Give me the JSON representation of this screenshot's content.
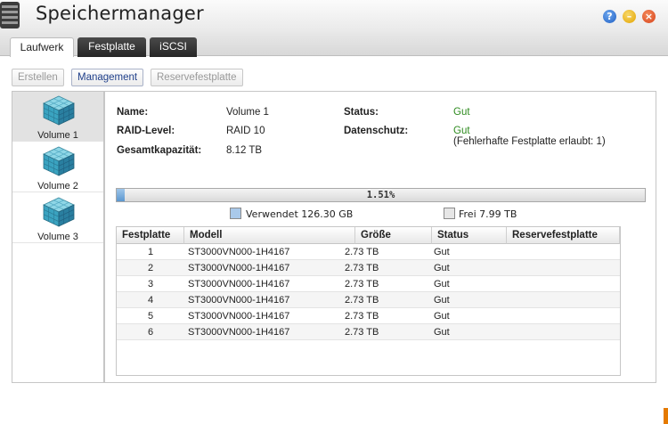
{
  "window": {
    "title": "Speichermanager"
  },
  "tabs": [
    {
      "label": "Laufwerk"
    },
    {
      "label": "Festplatte"
    },
    {
      "label": "iSCSI"
    }
  ],
  "toolbar": {
    "create_label": "Erstellen",
    "management_label": "Management",
    "spare_label": "Reservefestplatte"
  },
  "volumes": [
    {
      "label": "Volume 1"
    },
    {
      "label": "Volume 2"
    },
    {
      "label": "Volume 3"
    }
  ],
  "details": {
    "name_label": "Name:",
    "name_value": "Volume 1",
    "raid_label": "RAID-Level:",
    "raid_value": "RAID 10",
    "capacity_label": "Gesamtkapazität:",
    "capacity_value": "8.12 TB",
    "status_label": "Status:",
    "status_value": "Gut",
    "protection_label": "Datenschutz:",
    "protection_value": "Gut",
    "protection_note": "(Fehlerhafte Festplatte erlaubt: 1)"
  },
  "usage": {
    "percent_text": "1.51%",
    "percent_value": 1.51,
    "used_label": "Verwendet 126.30 GB",
    "free_label": "Frei 7.99 TB"
  },
  "table": {
    "headers": [
      "Festplatte",
      "Modell",
      "Größe",
      "Status",
      "Reservefestplatte"
    ],
    "rows": [
      {
        "disk": "1",
        "model": "ST3000VN000-1H4167",
        "size": "2.73 TB",
        "status": "Gut",
        "spare": ""
      },
      {
        "disk": "2",
        "model": "ST3000VN000-1H4167",
        "size": "2.73 TB",
        "status": "Gut",
        "spare": ""
      },
      {
        "disk": "3",
        "model": "ST3000VN000-1H4167",
        "size": "2.73 TB",
        "status": "Gut",
        "spare": ""
      },
      {
        "disk": "4",
        "model": "ST3000VN000-1H4167",
        "size": "2.73 TB",
        "status": "Gut",
        "spare": ""
      },
      {
        "disk": "5",
        "model": "ST3000VN000-1H4167",
        "size": "2.73 TB",
        "status": "Gut",
        "spare": ""
      },
      {
        "disk": "6",
        "model": "ST3000VN000-1H4167",
        "size": "2.73 TB",
        "status": "Gut",
        "spare": ""
      }
    ]
  },
  "colors": {
    "good": "#2e8b1f",
    "accent": "#1f3f8a",
    "progress_fill": "#5c97cf"
  },
  "icons": {
    "app": "storage-manager-icon",
    "help": "help-icon",
    "minimize": "minimize-icon",
    "close": "close-icon",
    "volume": "volume-cube-icon"
  }
}
